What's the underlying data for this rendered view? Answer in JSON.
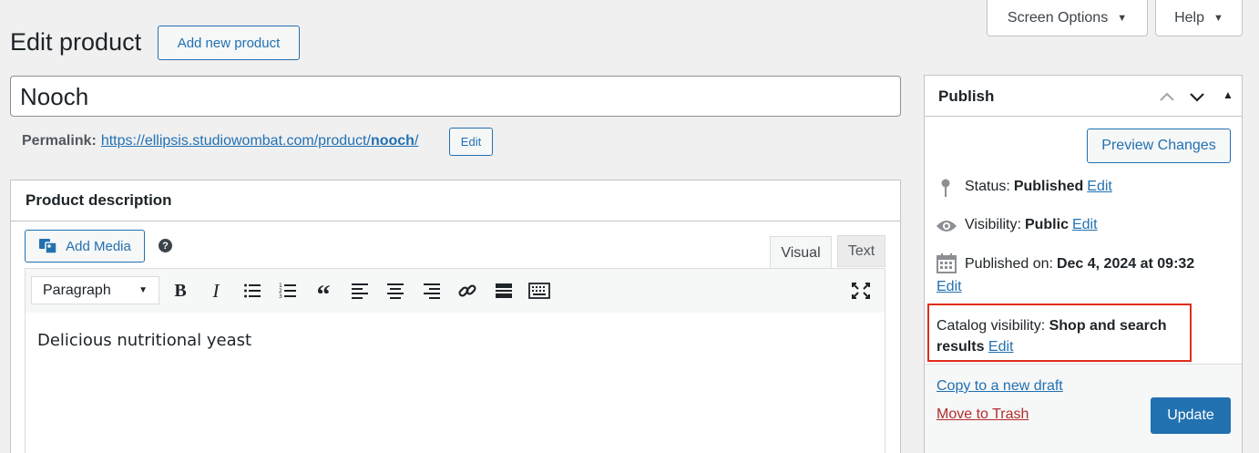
{
  "top_buttons": {
    "screen_options": "Screen Options",
    "help": "Help"
  },
  "header": {
    "title": "Edit product",
    "add_new": "Add new product"
  },
  "product": {
    "title": "Nooch",
    "permalink_label": "Permalink:",
    "permalink_base": "https://ellipsis.studiowombat.com/product/",
    "permalink_slug": "nooch",
    "permalink_tail": "/",
    "permalink_edit": "Edit"
  },
  "description": {
    "heading": "Product description",
    "add_media": "Add Media",
    "help": "?",
    "tab_visual": "Visual",
    "tab_text": "Text",
    "format": "Paragraph",
    "content": "Delicious nutritional yeast"
  },
  "publish": {
    "heading": "Publish",
    "preview": "Preview Changes",
    "status_label": "Status:",
    "status_value": "Published",
    "visibility_label": "Visibility:",
    "visibility_value": "Public",
    "published_label": "Published on:",
    "published_value": "Dec 4, 2024 at 09:32",
    "edit": "Edit",
    "catalog_label": "Catalog visibility:",
    "catalog_value_1": "Shop and search",
    "catalog_value_2": "results",
    "copy_draft": "Copy to a new draft",
    "trash": "Move to Trash",
    "update": "Update"
  },
  "colors": {
    "accent": "#2271b1",
    "danger": "#b32d2e",
    "highlight": "#e02d1b"
  }
}
